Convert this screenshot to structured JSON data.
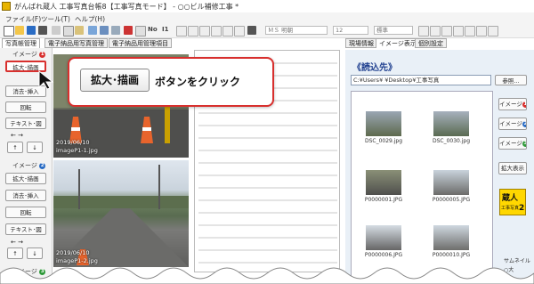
{
  "window": {
    "title": "がんばれ蔵人 工事写真台帳8【工事写真モード】 - ○○ビル補修工事 *"
  },
  "menu": [
    "ファイル(F)",
    "ツール(T)",
    "ヘルプ(H)"
  ],
  "toolbar": {
    "font_combo": "ＭＳ 明朝",
    "size_combo": "12",
    "style_combo": "標準",
    "no_label": "No",
    "i_label": "I1",
    "colors": {
      "accent": "#2a6cc4"
    }
  },
  "left_tabs": [
    "写真帳管理",
    "電子納品用写真管理",
    "電子納品用管理項目"
  ],
  "right_tabs": [
    "現場情報",
    "イメージ表示",
    "個別設定"
  ],
  "image_panels": [
    {
      "label": "イメージ",
      "badge": "1",
      "buttons": [
        "拡大･描画",
        "消去･挿入",
        "回転",
        "テキスト･図"
      ],
      "arrows_h": "← →",
      "arrow_up": "↑",
      "arrow_down": "↓",
      "caption_date": "2019/06/10",
      "caption_file": "imageP1-1.jpg"
    },
    {
      "label": "イメージ",
      "badge": "2",
      "buttons": [
        "拡大･描画",
        "消去･挿入",
        "回転",
        "テキスト･図"
      ],
      "arrows_h": "← →",
      "arrow_up": "↑",
      "arrow_down": "↓",
      "caption_date": "2019/06/10",
      "caption_file": "imageP1-2.jpg"
    }
  ],
  "third_panel_label": "イメージ",
  "third_panel_badge": "3",
  "callout": {
    "button_label": "拡大･描画",
    "text": "ボタンをクリック"
  },
  "right_panel": {
    "title": "《読込先》",
    "path": "C:¥Users¥   ¥Desktop¥工事写真",
    "ref_button": "参照...",
    "thumbnails": [
      {
        "name": "DSC_0029.jpg"
      },
      {
        "name": "DSC_0030.jpg"
      },
      {
        "name": "P0000001.JPG"
      },
      {
        "name": "P0000005.JPG"
      },
      {
        "name": "P0000006.JPG"
      },
      {
        "name": "P0000010.JPG"
      }
    ],
    "side_buttons": [
      {
        "label": "イメージ",
        "badge": "1"
      },
      {
        "label": "イメージ",
        "badge": "2"
      },
      {
        "label": "イメージ",
        "badge": "3"
      }
    ],
    "enlarge_button": "拡大表示",
    "logo_text": "蔵人",
    "logo_sub": "工事写真",
    "logo_num": "2",
    "thumb_size_label": "サムネイル",
    "thumb_size_value": "大"
  }
}
